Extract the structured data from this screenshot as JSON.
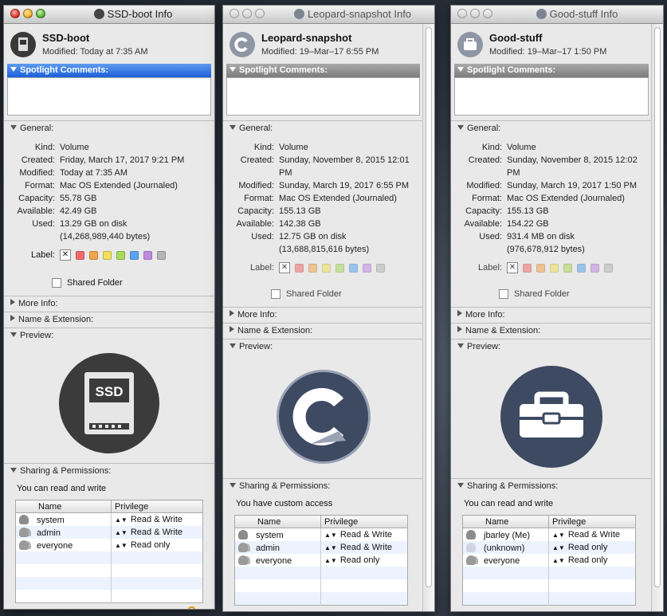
{
  "windows": [
    {
      "title": "SSD-boot Info",
      "name": "SSD-boot",
      "modified": "Modified: Today at 7:35 AM",
      "sections": {
        "spotlight": "Spotlight Comments:",
        "general": "General:",
        "more_info": "More Info:",
        "name_ext": "Name & Extension:",
        "preview": "Preview:",
        "sharing": "Sharing & Permissions:"
      },
      "general": {
        "kind_label": "Kind:",
        "kind": "Volume",
        "created_label": "Created:",
        "created": "Friday, March 17, 2017 9:21 PM",
        "modified_label": "Modified:",
        "modified": "Today at 7:35 AM",
        "format_label": "Format:",
        "format": "Mac OS Extended (Journaled)",
        "capacity_label": "Capacity:",
        "capacity": "55.78 GB",
        "available_label": "Available:",
        "available": "42.49 GB",
        "used_label": "Used:",
        "used": "13.29 GB on disk",
        "used_bytes": "(14,268,989,440 bytes)",
        "label_label": "Label:",
        "shared_folder": "Shared Folder"
      },
      "preview_badge": "SSD",
      "access_text": "You can read and write",
      "perm_headers": [
        "Name",
        "Privilege"
      ],
      "permissions": [
        {
          "name": "system",
          "privilege": "Read & Write"
        },
        {
          "name": "admin",
          "privilege": "Read & Write"
        },
        {
          "name": "everyone",
          "privilege": "Read only"
        }
      ],
      "buttons": {
        "plus": "+",
        "minus": "−",
        "gear": "⚙▾"
      }
    },
    {
      "title": "Leopard-snapshot Info",
      "name": "Leopard-snapshot",
      "modified": "Modified: 19–Mar–17 6:55 PM",
      "sections": {
        "spotlight": "Spotlight Comments:",
        "general": "General:",
        "more_info": "More Info:",
        "name_ext": "Name & Extension:",
        "preview": "Preview:",
        "sharing": "Sharing & Permissions:"
      },
      "general": {
        "kind_label": "Kind:",
        "kind": "Volume",
        "created_label": "Created:",
        "created": "Sunday, November 8, 2015 12:01 PM",
        "modified_label": "Modified:",
        "modified": "Sunday, March 19, 2017 6:55 PM",
        "format_label": "Format:",
        "format": "Mac OS Extended (Journaled)",
        "capacity_label": "Capacity:",
        "capacity": "155.13 GB",
        "available_label": "Available:",
        "available": "142.38 GB",
        "used_label": "Used:",
        "used": "12.75 GB on disk",
        "used_bytes": "(13,688,815,616 bytes)",
        "label_label": "Label:",
        "shared_folder": "Shared Folder"
      },
      "access_text": "You have custom access",
      "perm_headers": [
        "Name",
        "Privilege"
      ],
      "permissions": [
        {
          "name": "system",
          "privilege": "Read & Write"
        },
        {
          "name": "admin",
          "privilege": "Read & Write"
        },
        {
          "name": "everyone",
          "privilege": "Read only"
        }
      ]
    },
    {
      "title": "Good-stuff Info",
      "name": "Good-stuff",
      "modified": "Modified: 19–Mar–17 1:50 PM",
      "sections": {
        "spotlight": "Spotlight Comments:",
        "general": "General:",
        "more_info": "More Info:",
        "name_ext": "Name & Extension:",
        "preview": "Preview:",
        "sharing": "Sharing & Permissions:"
      },
      "general": {
        "kind_label": "Kind:",
        "kind": "Volume",
        "created_label": "Created:",
        "created": "Sunday, November 8, 2015 12:02 PM",
        "modified_label": "Modified:",
        "modified": "Sunday, March 19, 2017 1:50 PM",
        "format_label": "Format:",
        "format": "Mac OS Extended (Journaled)",
        "capacity_label": "Capacity:",
        "capacity": "155.13 GB",
        "available_label": "Available:",
        "available": "154.22 GB",
        "used_label": "Used:",
        "used": "931.4 MB on disk",
        "used_bytes": "(976,678,912 bytes)",
        "label_label": "Label:",
        "shared_folder": "Shared Folder"
      },
      "access_text": "You can read and write",
      "perm_headers": [
        "Name",
        "Privilege"
      ],
      "permissions": [
        {
          "name": "jbarley (Me)",
          "privilege": "Read & Write"
        },
        {
          "name": "(unknown)",
          "privilege": "Read only"
        },
        {
          "name": "everyone",
          "privilege": "Read only"
        }
      ]
    }
  ],
  "label_colors": [
    "#f26b6b",
    "#f2a54a",
    "#f0e05a",
    "#a8d95a",
    "#5aa5ef",
    "#c08ae0",
    "#b5b5b5"
  ],
  "icons": {
    "window1": "ssd-icon",
    "window2": "carbon-copy-icon",
    "window3": "toolbox-icon"
  }
}
